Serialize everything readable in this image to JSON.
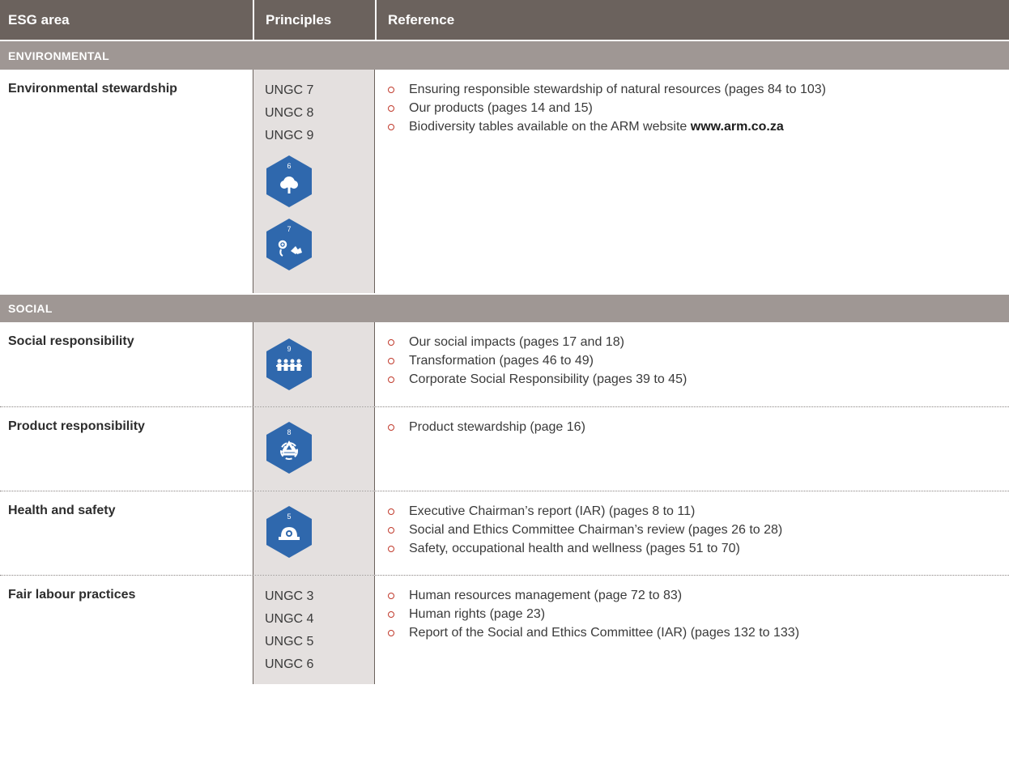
{
  "header": {
    "col1": "ESG area",
    "col2": "Principles",
    "col3": "Reference"
  },
  "sections": {
    "environmental": "ENVIRONMENTAL",
    "social": "SOCIAL"
  },
  "rows": {
    "env_stewardship": {
      "area": "Environmental stewardship",
      "principles": [
        "UNGC 7",
        "UNGC 8",
        "UNGC 9"
      ],
      "badges": [
        {
          "number": "6",
          "icon": "tree-icon"
        },
        {
          "number": "7",
          "icon": "flower-butterfly-icon"
        }
      ],
      "refs": [
        "Ensuring responsible stewardship of natural resources (pages 84 to 103)",
        "Our products (pages 14 and 15)",
        "Biodiversity tables available on the ARM website"
      ],
      "website": "www.arm.co.za"
    },
    "social_resp": {
      "area": "Social responsibility",
      "badges": [
        {
          "number": "9",
          "icon": "community-icon"
        }
      ],
      "refs": [
        "Our social impacts (pages 17 and 18)",
        "Transformation (pages 46 to 49)",
        "Corporate Social Responsibility (pages 39 to 45)"
      ]
    },
    "product_resp": {
      "area": "Product responsibility",
      "badges": [
        {
          "number": "8",
          "icon": "recycle-icon"
        }
      ],
      "refs": [
        "Product stewardship (page 16)"
      ]
    },
    "health_safety": {
      "area": "Health and safety",
      "badges": [
        {
          "number": "5",
          "icon": "hard-hat-icon"
        }
      ],
      "refs": [
        "Executive Chairman’s report (IAR) (pages 8 to 11)",
        "Social and Ethics Committee Chairman’s review (pages 26 to 28)",
        "Safety, occupational health and wellness (pages 51 to 70)"
      ]
    },
    "fair_labour": {
      "area": "Fair labour practices",
      "principles": [
        "UNGC 3",
        "UNGC 4",
        "UNGC 5",
        "UNGC 6"
      ],
      "refs": [
        "Human resources management (page 72 to 83)",
        "Human rights (page 23)",
        "Report of the Social and Ethics Committee (IAR) (pages 132 to 133)"
      ]
    }
  },
  "colors": {
    "header_bg": "#6b625d",
    "section_bg": "#9f9794",
    "principles_bg": "#e4e0df",
    "badge_blue": "#2f68ad",
    "bullet": "#c0392b"
  }
}
